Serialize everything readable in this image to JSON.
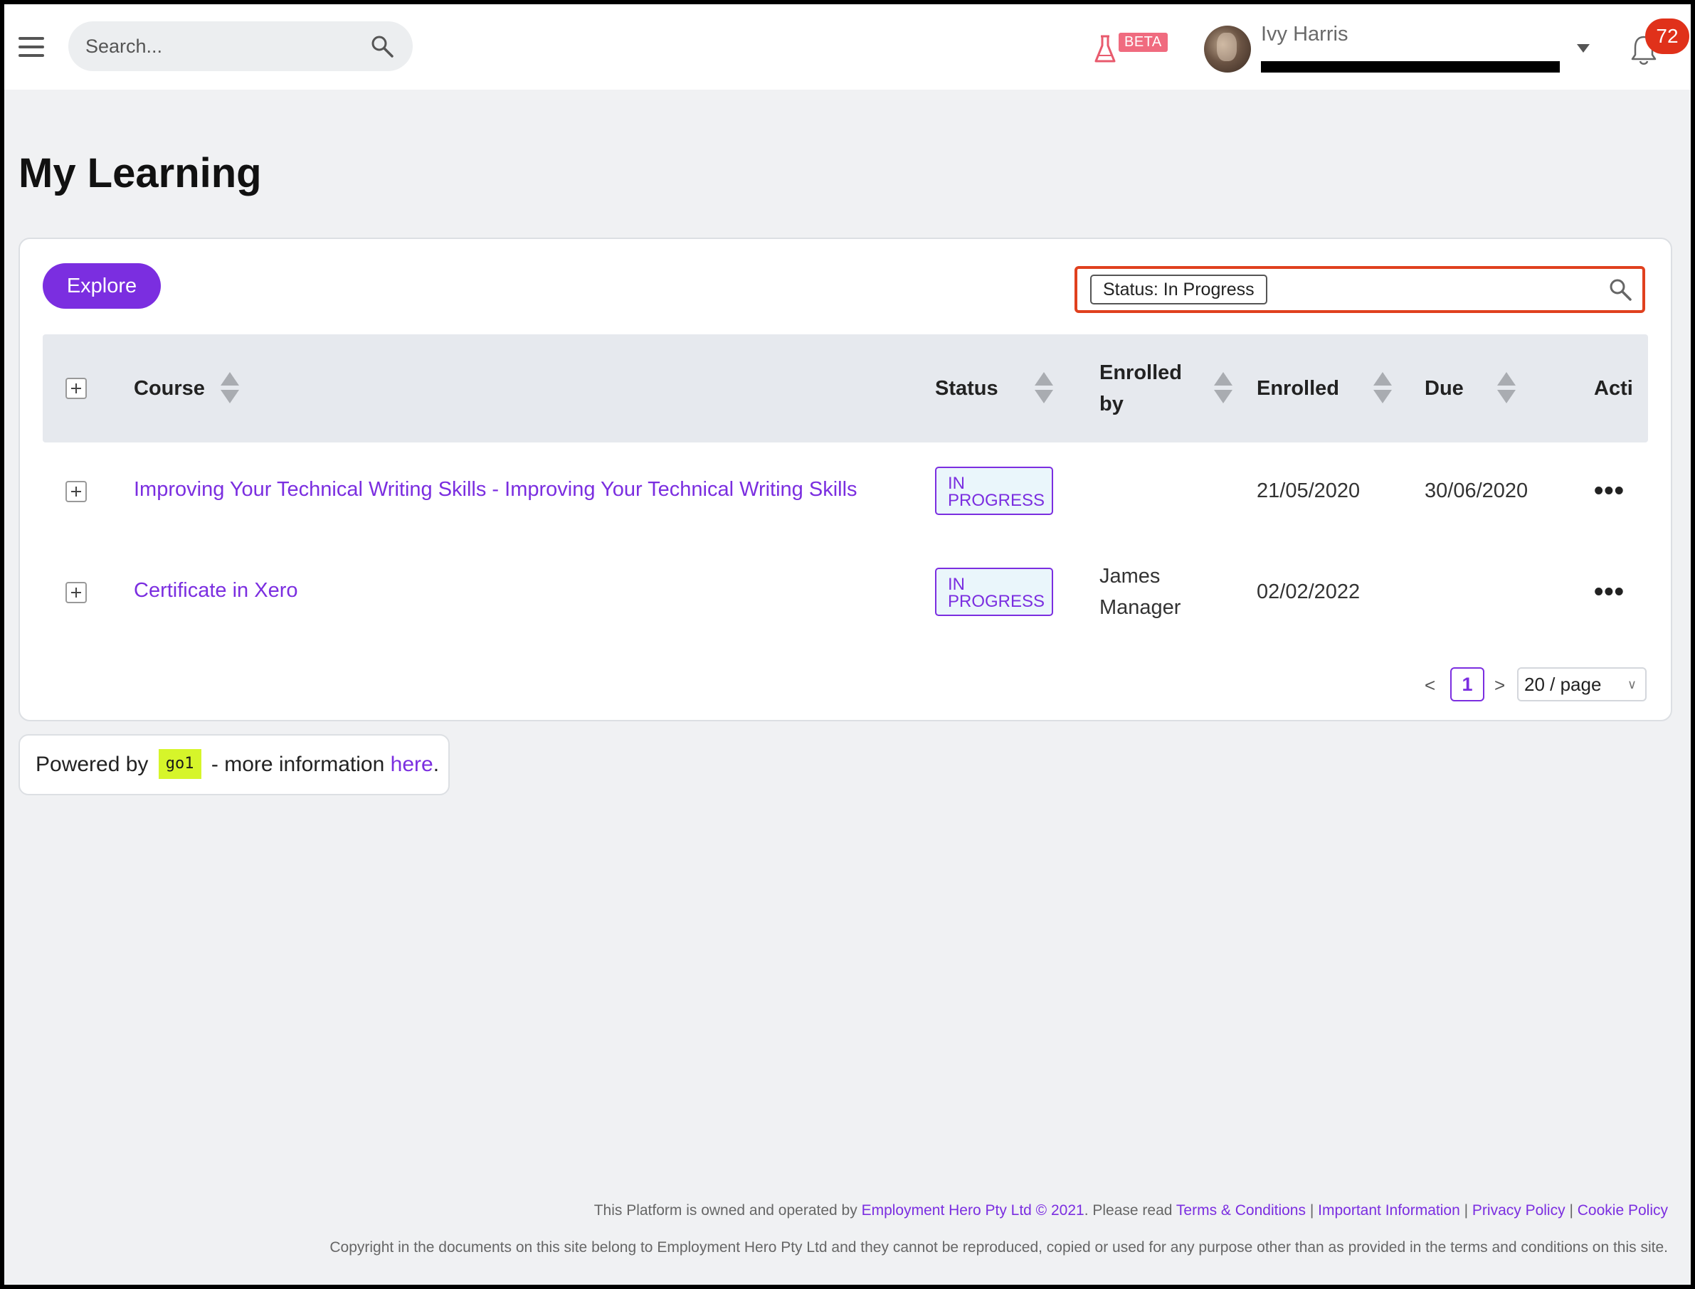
{
  "topbar": {
    "search_placeholder": "Search...",
    "beta_label": "BETA",
    "user_name": "Ivy Harris",
    "notification_count": "72",
    "icons": [
      "menu-icon",
      "search-icon",
      "flask-icon",
      "chevron-down-icon",
      "bell-icon"
    ]
  },
  "page": {
    "title": "My Learning"
  },
  "toolbar": {
    "explore_label": "Explore",
    "filter_chip": "Status: In Progress"
  },
  "table": {
    "columns": {
      "course": "Course",
      "status": "Status",
      "enrolled_by_line1": "Enrolled",
      "enrolled_by_line2": "by",
      "enrolled": "Enrolled",
      "due": "Due",
      "actions": "Acti"
    },
    "rows": [
      {
        "course": "Improving Your Technical Writing Skills - Improving Your Technical Writing Skills",
        "status_line1": "IN",
        "status_line2": "PROGRESS",
        "enrolled_by_line1": "",
        "enrolled_by_line2": "",
        "enrolled": "21/05/2020",
        "due": "30/06/2020",
        "actions": "•••"
      },
      {
        "course": "Certificate in Xero",
        "status_line1": "IN",
        "status_line2": "PROGRESS",
        "enrolled_by_line1": "James",
        "enrolled_by_line2": "Manager",
        "enrolled": "02/02/2022",
        "due": "",
        "actions": "•••"
      }
    ]
  },
  "pagination": {
    "prev": "<",
    "current_page": "1",
    "next": ">",
    "page_size": "20 / page"
  },
  "powered": {
    "prefix": "Powered by",
    "logo_text": "go1",
    "middle": "- more information",
    "link": "here",
    "suffix": "."
  },
  "footer": {
    "owned_prefix": "This Platform is owned and operated by",
    "company_link": "Employment Hero Pty Ltd © 2021",
    "please_read": ". Please read",
    "terms": "Terms & Conditions",
    "important": "Important Information",
    "privacy": "Privacy Policy",
    "cookie": "Cookie Policy",
    "sep": "|",
    "copyright": "Copyright in the documents on this site belong to Employment Hero Pty Ltd and they cannot be reproduced, copied or used for any purpose other than as provided in the terms and conditions on this site."
  },
  "colors": {
    "accent": "#7b2ee0",
    "highlight_border": "#e0401e",
    "badge": "#e0311a",
    "beta": "#f06b7f",
    "go1_logo": "#d6f52a"
  }
}
